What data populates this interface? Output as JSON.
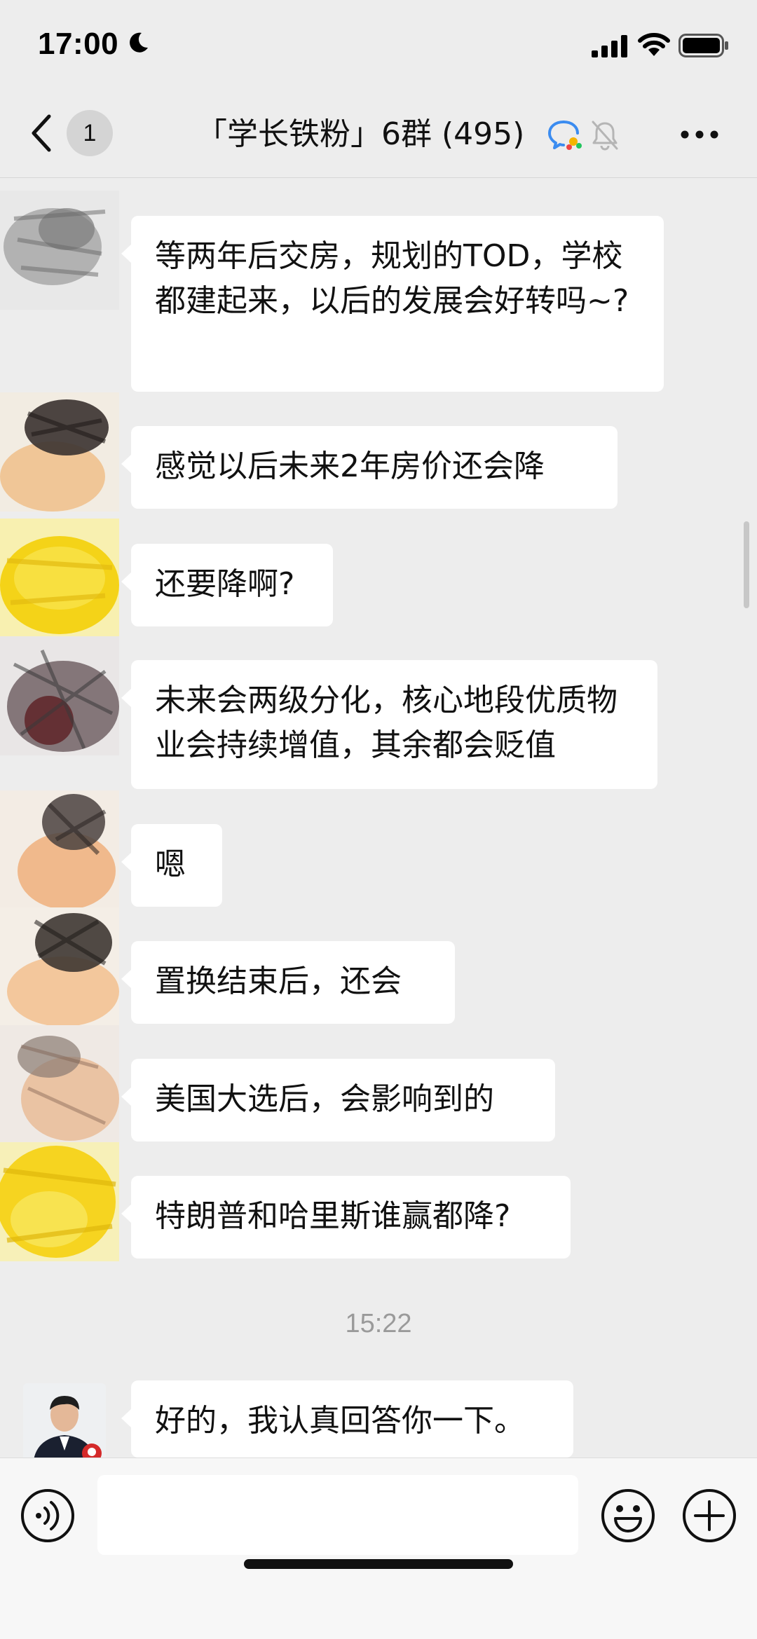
{
  "status_bar": {
    "time": "17:00"
  },
  "nav": {
    "unread_count": "1",
    "title": "「学长铁粉」6群 (495)"
  },
  "messages": [
    {
      "text": "等两年后交房，规划的TOD，学校都建起来，以后的发展会好转吗~?"
    },
    {
      "text": "感觉以后未来2年房价还会降"
    },
    {
      "text": "还要降啊?"
    },
    {
      "text": "未来会两级分化，核心地段优质物业会持续增值，其余都会贬值"
    },
    {
      "text": "嗯"
    },
    {
      "text": "置换结束后，还会"
    },
    {
      "text": "美国大选后，会影响到的"
    },
    {
      "text": "特朗普和哈里斯谁赢都降?"
    }
  ],
  "time_separator": "15:22",
  "last_message": {
    "text": "好的，我认真回答你一下。"
  },
  "input": {
    "value": ""
  }
}
